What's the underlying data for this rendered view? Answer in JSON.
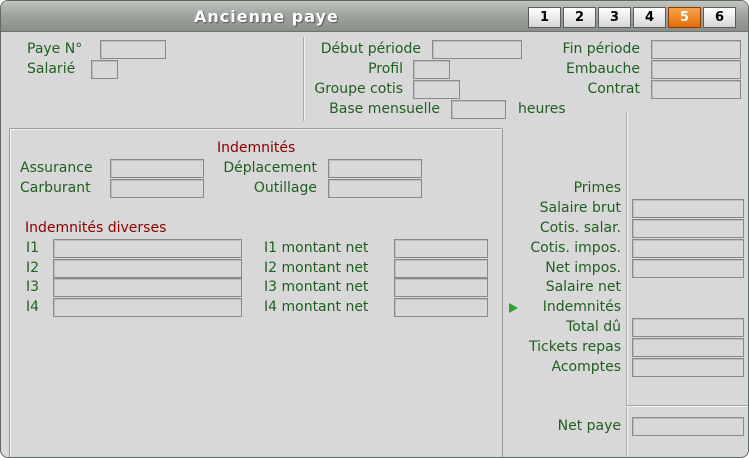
{
  "window": {
    "title": "Ancienne paye"
  },
  "tabs": [
    {
      "label": "1",
      "active": false
    },
    {
      "label": "2",
      "active": false
    },
    {
      "label": "3",
      "active": false
    },
    {
      "label": "4",
      "active": false
    },
    {
      "label": "5",
      "active": true
    },
    {
      "label": "6",
      "active": false
    }
  ],
  "header": {
    "paye_no": "Paye N°",
    "salarie": "Salarié",
    "debut_periode": "Début période",
    "profil": "Profil",
    "groupe_cotis": "Groupe cotis",
    "base_mensuelle": "Base mensuelle",
    "heures": "heures",
    "fin_periode": "Fin période",
    "embauche": "Embauche",
    "contrat": "Contrat"
  },
  "indemnites": {
    "title": "Indemnités",
    "assurance": "Assurance",
    "carburant": "Carburant",
    "deplacement": "Déplacement",
    "outillage": "Outillage"
  },
  "indemnites_diverses": {
    "title": "Indemnités diverses",
    "rows": [
      {
        "label": "I1",
        "net_label": "I1 montant net"
      },
      {
        "label": "I2",
        "net_label": "I2 montant net"
      },
      {
        "label": "I3",
        "net_label": "I3 montant net"
      },
      {
        "label": "I4",
        "net_label": "I4 montant net"
      }
    ]
  },
  "totals": {
    "primes": "Primes",
    "salaire_brut": "Salaire brut",
    "cotis_salar": "Cotis. salar.",
    "cotis_impos": "Cotis. impos.",
    "net_impos": "Net impos.",
    "salaire_net": "Salaire net",
    "indemnites": "Indemnités",
    "total_du": "Total dû",
    "tickets_repas": "Tickets repas",
    "acomptes": "Acomptes",
    "net_paye": "Net paye"
  },
  "colors": {
    "label": "#1f5f1f",
    "section_header": "#8b0000",
    "active_tab": "#e36d0c",
    "background": "#d8d8d8"
  }
}
